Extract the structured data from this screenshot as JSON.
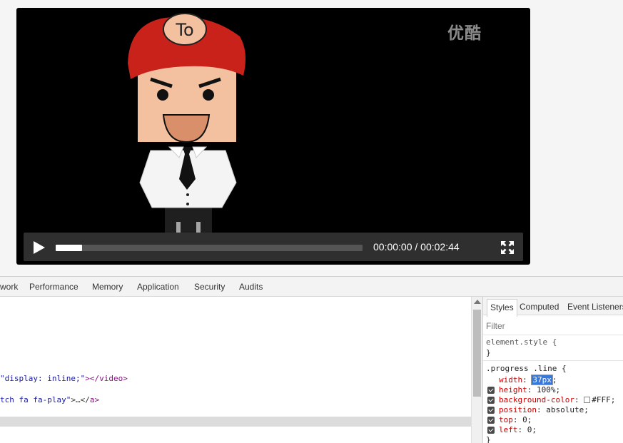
{
  "video": {
    "watermark": "优酷",
    "character_cap_text": "To",
    "current_time": "00:00:00",
    "duration": "00:02:44",
    "time_display": "00:00:00 / 00:02:44",
    "progress_fraction": 0.086
  },
  "devtools": {
    "tabs": [
      "work",
      "Performance",
      "Memory",
      "Application",
      "Security",
      "Audits"
    ],
    "elements": {
      "line1": {
        "attr_value": "\"display: inline;\"",
        "close_tag": "></video>"
      },
      "line2": {
        "attr_value": "tch fa fa-play\"",
        "ellipsis": ">…</",
        "close_tag": "a>"
      }
    },
    "styles": {
      "tabs": [
        "Styles",
        "Computed",
        "Event Listeners"
      ],
      "filter_placeholder": "Filter",
      "element_style": {
        "selector": "element.style {",
        "close": "}"
      },
      "rule": {
        "selector": ".progress .line {",
        "close": "}",
        "decls": [
          {
            "prop": "width",
            "value": "37px"
          },
          {
            "prop": "height",
            "value": "100%"
          },
          {
            "prop": "background-color",
            "value": "#FFF"
          },
          {
            "prop": "position",
            "value": "absolute"
          },
          {
            "prop": "top",
            "value": "0"
          },
          {
            "prop": "left",
            "value": "0"
          }
        ]
      }
    }
  },
  "colors": {
    "video_bg": "#000000",
    "controls_bg": "#2f2f2f",
    "progress_fill": "#ffffff",
    "cap_red": "#c8221a",
    "css_property": "#c80000",
    "selection_blue": "#3878d8"
  },
  "icons": [
    "play-icon",
    "fullscreen-icon",
    "checkbox-icon",
    "color-swatch-icon"
  ]
}
